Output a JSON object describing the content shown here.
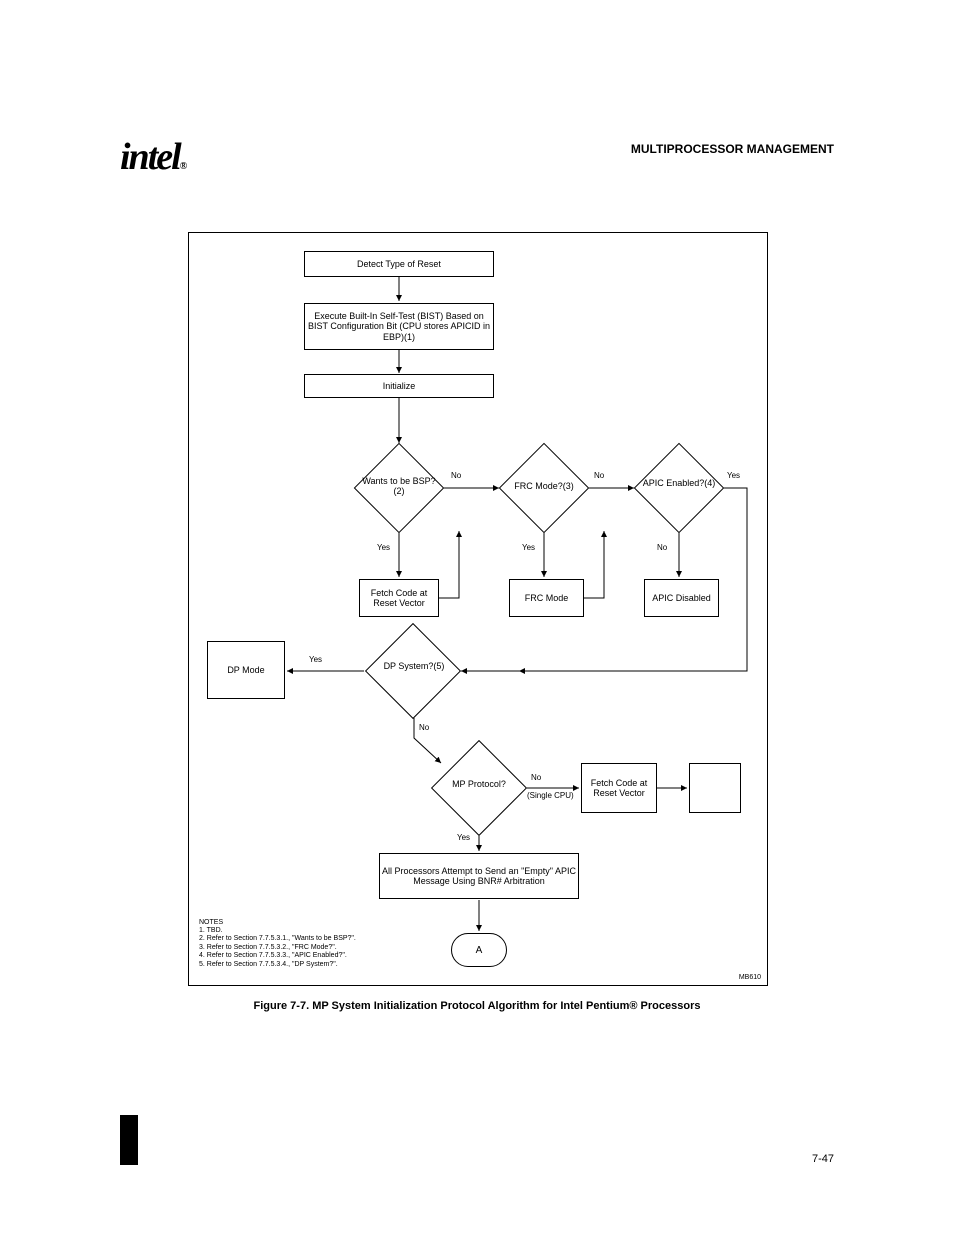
{
  "header": "MULTIPROCESSOR MANAGEMENT",
  "logo_text": "intel",
  "logo_mark": "®",
  "page_number": "7-47",
  "figure_caption": "Figure 7-7.  MP System Initialization Protocol Algorithm for Intel Pentium® Processors",
  "fig_id": "MB610",
  "nodes": {
    "detect_reset": "Detect Type of Reset",
    "execute_bist": "Execute Built-In Self-Test (BIST) Based on BIST Configuration Bit\n(CPU stores APICID in EBP)(1)",
    "initialize": "Initialize",
    "want_bsp_q": "Wants to be BSP?(2)",
    "frc_mode_q": "FRC Mode?(3)",
    "apic_enabled_q": "APIC Enabled?(4)",
    "frc_mode_a": "FRC Mode",
    "apic_disabled_a": "APIC Disabled",
    "fetch_code_a": "Fetch Code at Reset Vector",
    "dp_system_q": "DP System?(5)",
    "mp_protocol_q": "MP Protocol?",
    "dp_mode_a": "DP Mode",
    "fetch_code_b": "Fetch Code at Reset Vector",
    "attempt_bnr": "All Processors Attempt to Send an \"Empty\" APIC Message Using BNR# Arbitration",
    "a_terminal": "A"
  },
  "edges": {
    "yes": "Yes",
    "no": "No",
    "single_cpu": "(Single CPU)"
  },
  "notes": {
    "n1": "1. TBD.",
    "n2": "2. Refer to Section 7.7.5.3.1., \"Wants to be BSP?\".",
    "n3": "3. Refer to Section 7.7.5.3.2., \"FRC Mode?\".",
    "n4": "4. Refer to Section 7.7.5.3.3., \"APIC Enabled?\".",
    "n5": "5. Refer to Section 7.7.5.3.4., \"DP System?\"."
  }
}
